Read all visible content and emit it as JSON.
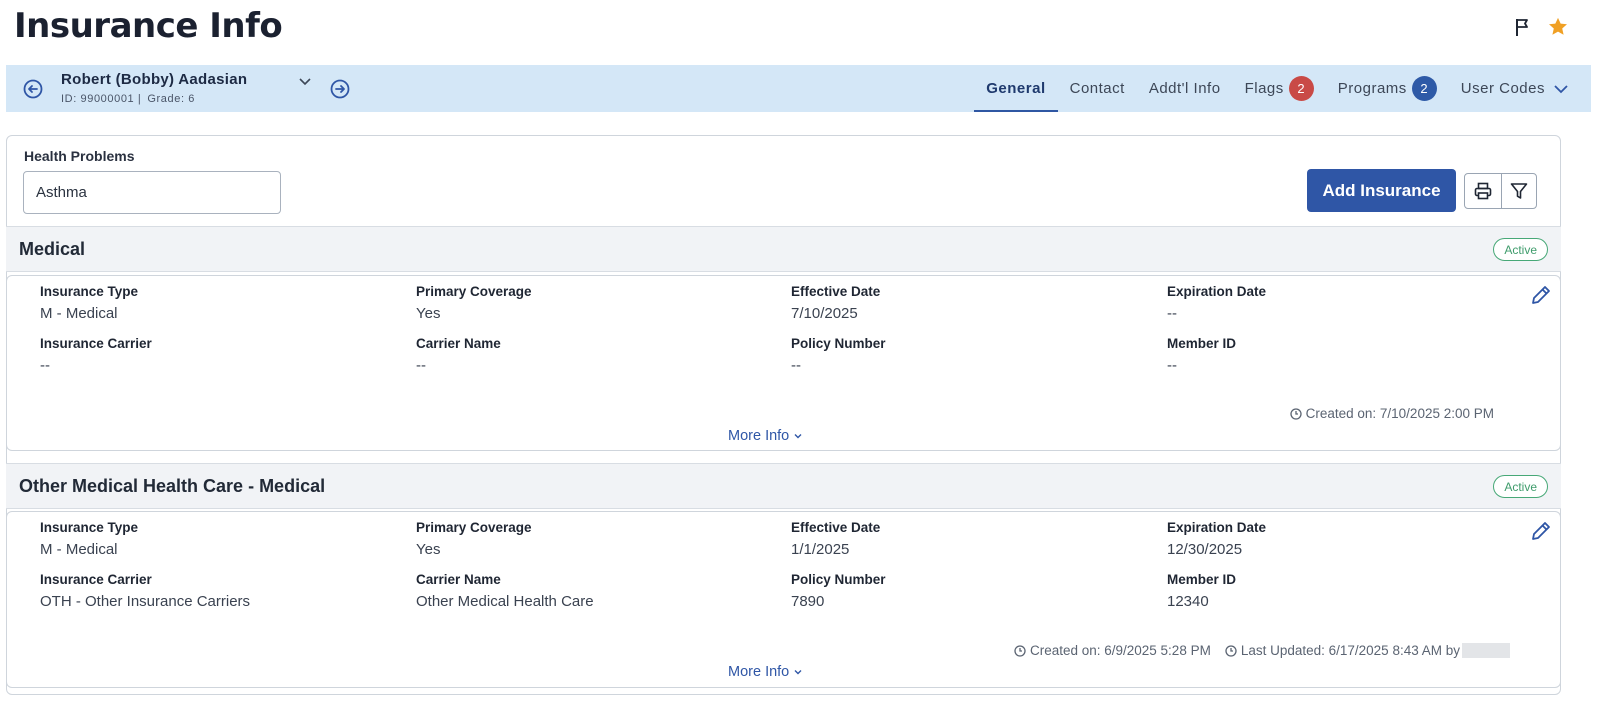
{
  "page": {
    "title": "Insurance Info"
  },
  "student": {
    "name": "Robert (Bobby) Aadasian",
    "id_text": "ID: 99000001 |",
    "grade_text": "Grade: 6"
  },
  "tabs": [
    {
      "label": "General",
      "active": true
    },
    {
      "label": "Contact"
    },
    {
      "label": "Addt'l Info"
    },
    {
      "label": "Flags",
      "badge": "2"
    },
    {
      "label": "Programs",
      "badge": "2"
    },
    {
      "label": "User Codes"
    }
  ],
  "health_problems": {
    "label": "Health Problems",
    "value": "Asthma"
  },
  "toolbar": {
    "add_label": "Add Insurance"
  },
  "colors": {
    "accent": "#2f56a6",
    "bar": "#d4e7f7",
    "active_green": "#3f9c6c",
    "flag_red": "#c94a46",
    "star": "#f0a024"
  },
  "insurances": [
    {
      "title": "Medical",
      "status": "Active",
      "fields": [
        {
          "label": "Insurance Type",
          "value": "M - Medical"
        },
        {
          "label": "Primary Coverage",
          "value": "Yes"
        },
        {
          "label": "Effective Date",
          "value": "7/10/2025"
        },
        {
          "label": "Expiration Date",
          "value": "--"
        },
        {
          "label": "Insurance Carrier",
          "value": "--"
        },
        {
          "label": "Carrier Name",
          "value": "--"
        },
        {
          "label": "Policy Number",
          "value": "--"
        },
        {
          "label": "Member ID",
          "value": "--"
        }
      ],
      "created": "Created on: 7/10/2025 2:00 PM",
      "more_info": "More Info"
    },
    {
      "title": "Other Medical Health Care - Medical",
      "status": "Active",
      "fields": [
        {
          "label": "Insurance Type",
          "value": "M - Medical"
        },
        {
          "label": "Primary Coverage",
          "value": "Yes"
        },
        {
          "label": "Effective Date",
          "value": "1/1/2025"
        },
        {
          "label": "Expiration Date",
          "value": "12/30/2025"
        },
        {
          "label": "Insurance Carrier",
          "value": "OTH - Other Insurance Carriers"
        },
        {
          "label": "Carrier Name",
          "value": "Other Medical Health Care"
        },
        {
          "label": "Policy Number",
          "value": "7890"
        },
        {
          "label": "Member ID",
          "value": "12340"
        }
      ],
      "created": "Created on: 6/9/2025 5:28 PM",
      "updated": "Last Updated: 6/17/2025 8:43 AM by",
      "more_info": "More Info"
    }
  ]
}
